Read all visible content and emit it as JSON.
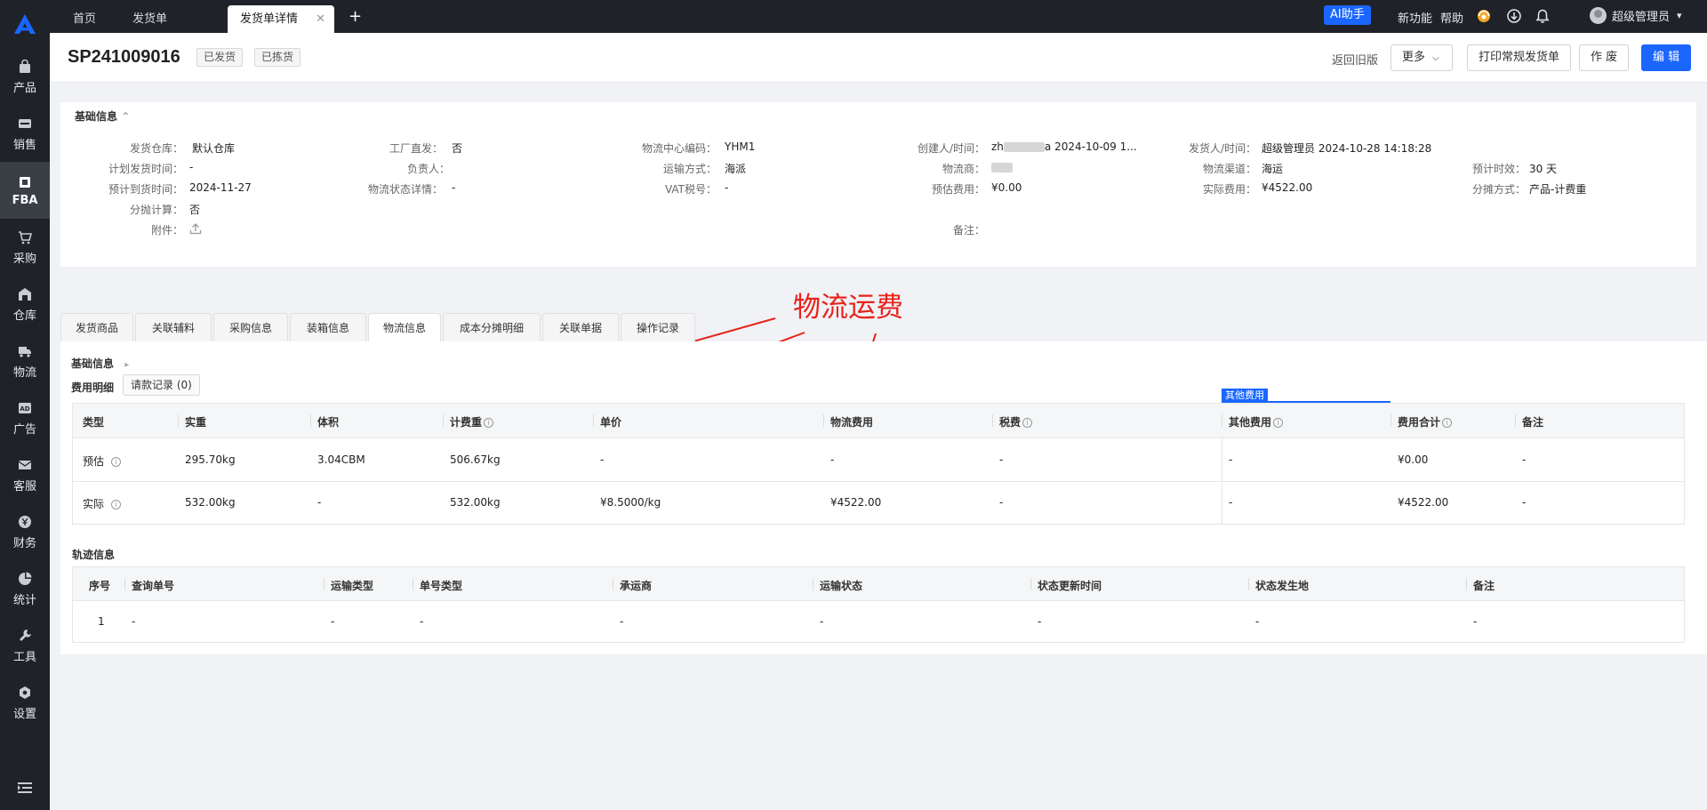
{
  "sidebar": {
    "items": [
      {
        "label": "产品",
        "icon": "bag-icon"
      },
      {
        "label": "销售",
        "icon": "sell-icon"
      },
      {
        "label": "FBA",
        "icon": "fba-icon"
      },
      {
        "label": "采购",
        "icon": "cart-icon"
      },
      {
        "label": "仓库",
        "icon": "warehouse-icon"
      },
      {
        "label": "物流",
        "icon": "truck-icon"
      },
      {
        "label": "广告",
        "icon": "ad-icon"
      },
      {
        "label": "客服",
        "icon": "mail-icon"
      },
      {
        "label": "财务",
        "icon": "yen-icon"
      },
      {
        "label": "统计",
        "icon": "pie-chart-icon"
      },
      {
        "label": "工具",
        "icon": "tool-icon"
      },
      {
        "label": "设置",
        "icon": "settings-icon"
      }
    ],
    "active": "FBA"
  },
  "topbar": {
    "tabs": [
      {
        "label": "首页"
      },
      {
        "label": "发货单"
      },
      {
        "label": "发货单详情",
        "closable": true
      }
    ],
    "close_glyph": "✕",
    "add_glyph": "+",
    "ai_label": "AI助手",
    "new_feature": "新功能",
    "help": "帮助",
    "user": "超级管理员",
    "user_caret": "▾"
  },
  "header": {
    "doc_no": "SP241009016",
    "tags": [
      "已发货",
      "已拣货"
    ],
    "back_old": "返回旧版",
    "more": "更多",
    "more_caret": "⌵",
    "print": "打印常规发货单",
    "void": "作 废",
    "edit": "编 辑"
  },
  "basic": {
    "title": "基础信息",
    "title_caret": "⌃",
    "fields": [
      {
        "label": "发货仓库：",
        "value": "默认仓库"
      },
      {
        "label": "工厂直发：",
        "value": "否"
      },
      {
        "label": "物流中心编码：",
        "value": "YHM1"
      },
      {
        "label": "创建人/时间：",
        "value_prefix": "zh",
        "value": "a 2024-10-09 1..."
      },
      {
        "label": "发货人/时间：",
        "value": "超级管理员 2024-10-28 14:18:28"
      },
      {
        "label": "计划发货时间：",
        "value": "-"
      },
      {
        "label": "负责人：",
        "value": ""
      },
      {
        "label": "运输方式：",
        "value": "海派"
      },
      {
        "label": "物流商：",
        "value": ""
      },
      {
        "label": "物流渠道：",
        "value": "海运"
      },
      {
        "label": "预计时效：",
        "value": "30 天"
      },
      {
        "label": "预计到货时间：",
        "value": "2024-11-27"
      },
      {
        "label": "物流状态详情：",
        "value": "-"
      },
      {
        "label": "VAT税号：",
        "value": "-"
      },
      {
        "label": "预估费用：",
        "value": "¥0.00"
      },
      {
        "label": "实际费用：",
        "value": "¥4522.00"
      },
      {
        "label": "分摊方式：",
        "value": "产品-计费重"
      },
      {
        "label": "分抛计算：",
        "value": "否"
      },
      {
        "label": "附件：",
        "value": ""
      },
      {
        "label": "备注：",
        "value": ""
      }
    ]
  },
  "annotation": "物流运费",
  "detail_tabs": [
    "发货商品",
    "关联辅料",
    "采购信息",
    "装箱信息",
    "物流信息",
    "成本分摊明细",
    "关联单据",
    "操作记录"
  ],
  "active_detail_tab": "物流信息",
  "logistics": {
    "section_title": "基础信息",
    "section_caret": "▸",
    "fee_title": "费用明细",
    "refund_btn": "请款记录 (0)",
    "group_label": "其他费用",
    "info_glyph": "i",
    "columns": [
      "类型",
      "实重",
      "体积",
      "计费重",
      "单价",
      "物流费用",
      "税费",
      "其他费用",
      "费用合计",
      "备注"
    ],
    "rows": [
      {
        "type": "预估",
        "weight": "295.70kg",
        "volume": "3.04CBM",
        "charge_weight": "506.67kg",
        "unit_price": "-",
        "fee": "-",
        "tax": "-",
        "other": "-",
        "total": "¥0.00",
        "note": "-"
      },
      {
        "type": "实际",
        "weight": "532.00kg",
        "volume": "-",
        "charge_weight": "532.00kg",
        "unit_price": "¥8.5000/kg",
        "fee": "¥4522.00",
        "tax": "-",
        "other": "-",
        "total": "¥4522.00",
        "note": "-"
      }
    ]
  },
  "track": {
    "title": "轨迹信息",
    "columns": [
      "序号",
      "查询单号",
      "运输类型",
      "单号类型",
      "承运商",
      "运输状态",
      "状态更新时间",
      "状态发生地",
      "备注"
    ],
    "rows": [
      [
        "1",
        "-",
        "-",
        "-",
        "-",
        "-",
        "-",
        "-",
        "-"
      ]
    ]
  },
  "colors": {
    "primary": "#1a66ff",
    "sidebar_bg": "#1f2329",
    "annotation": "#e8221a"
  }
}
